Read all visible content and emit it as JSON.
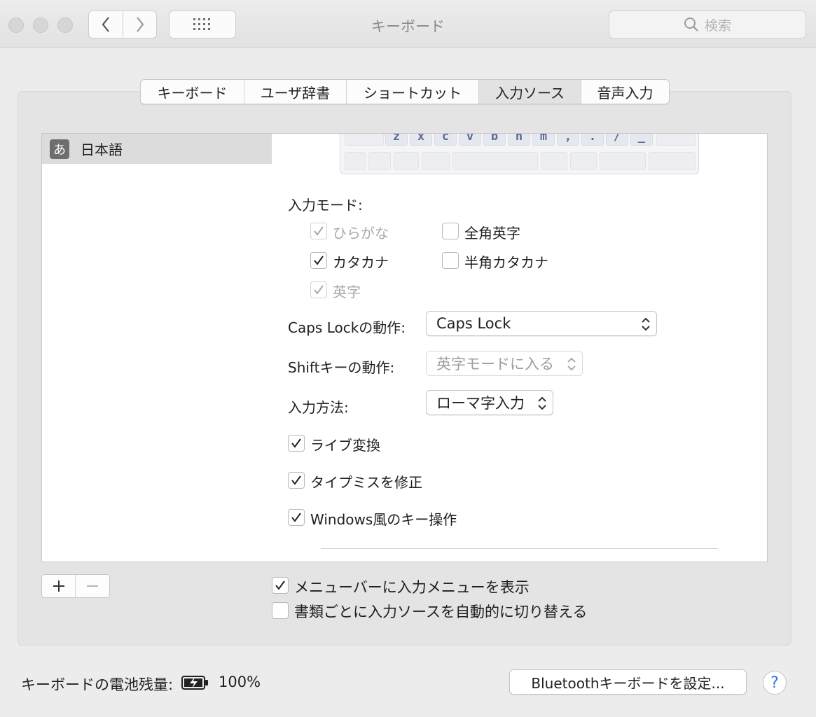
{
  "window": {
    "title": "キーボード"
  },
  "search": {
    "placeholder": "検索"
  },
  "tabs": [
    {
      "label": "キーボード"
    },
    {
      "label": "ユーザ辞書"
    },
    {
      "label": "ショートカット"
    },
    {
      "label": "入力ソース",
      "selected": true
    },
    {
      "label": "音声入力"
    }
  ],
  "source_list": {
    "items": [
      {
        "icon": "あ",
        "label": "日本語",
        "selected": true
      }
    ]
  },
  "keyboard_preview": {
    "keys": [
      "z",
      "x",
      "c",
      "v",
      "b",
      "n",
      "m",
      ",",
      ".",
      "/",
      "_"
    ]
  },
  "input_modes": {
    "heading": "入力モード:",
    "hiragana": {
      "label": "ひらがな",
      "checked": true,
      "enabled": false
    },
    "zenkaku_eiji": {
      "label": "全角英字",
      "checked": false
    },
    "katakana": {
      "label": "カタカナ",
      "checked": true
    },
    "hankaku_katakana": {
      "label": "半角カタカナ",
      "checked": false
    },
    "eiji": {
      "label": "英字",
      "checked": true,
      "enabled": false
    }
  },
  "caps_lock": {
    "label": "Caps Lockの動作:",
    "value": "Caps Lock"
  },
  "shift": {
    "label": "Shiftキーの動作:",
    "value": "英字モードに入る"
  },
  "input_method": {
    "label": "入力方法:",
    "value": "ローマ字入力"
  },
  "options": {
    "live_conversion": {
      "label": "ライブ変換",
      "checked": true
    },
    "typo_correction": {
      "label": "タイプミスを修正",
      "checked": true
    },
    "windows_keys": {
      "label": "Windows風のキー操作",
      "checked": true
    }
  },
  "bottom": {
    "show_menu": {
      "label": "メニューバーに入力メニューを表示",
      "checked": true
    },
    "auto_switch": {
      "label": "書類ごとに入力ソースを自動的に切り替える",
      "checked": false
    },
    "battery_label": "キーボードの電池残量:",
    "battery_value": "100%",
    "bluetooth_button": "Bluetoothキーボードを設定...",
    "help": "?"
  }
}
